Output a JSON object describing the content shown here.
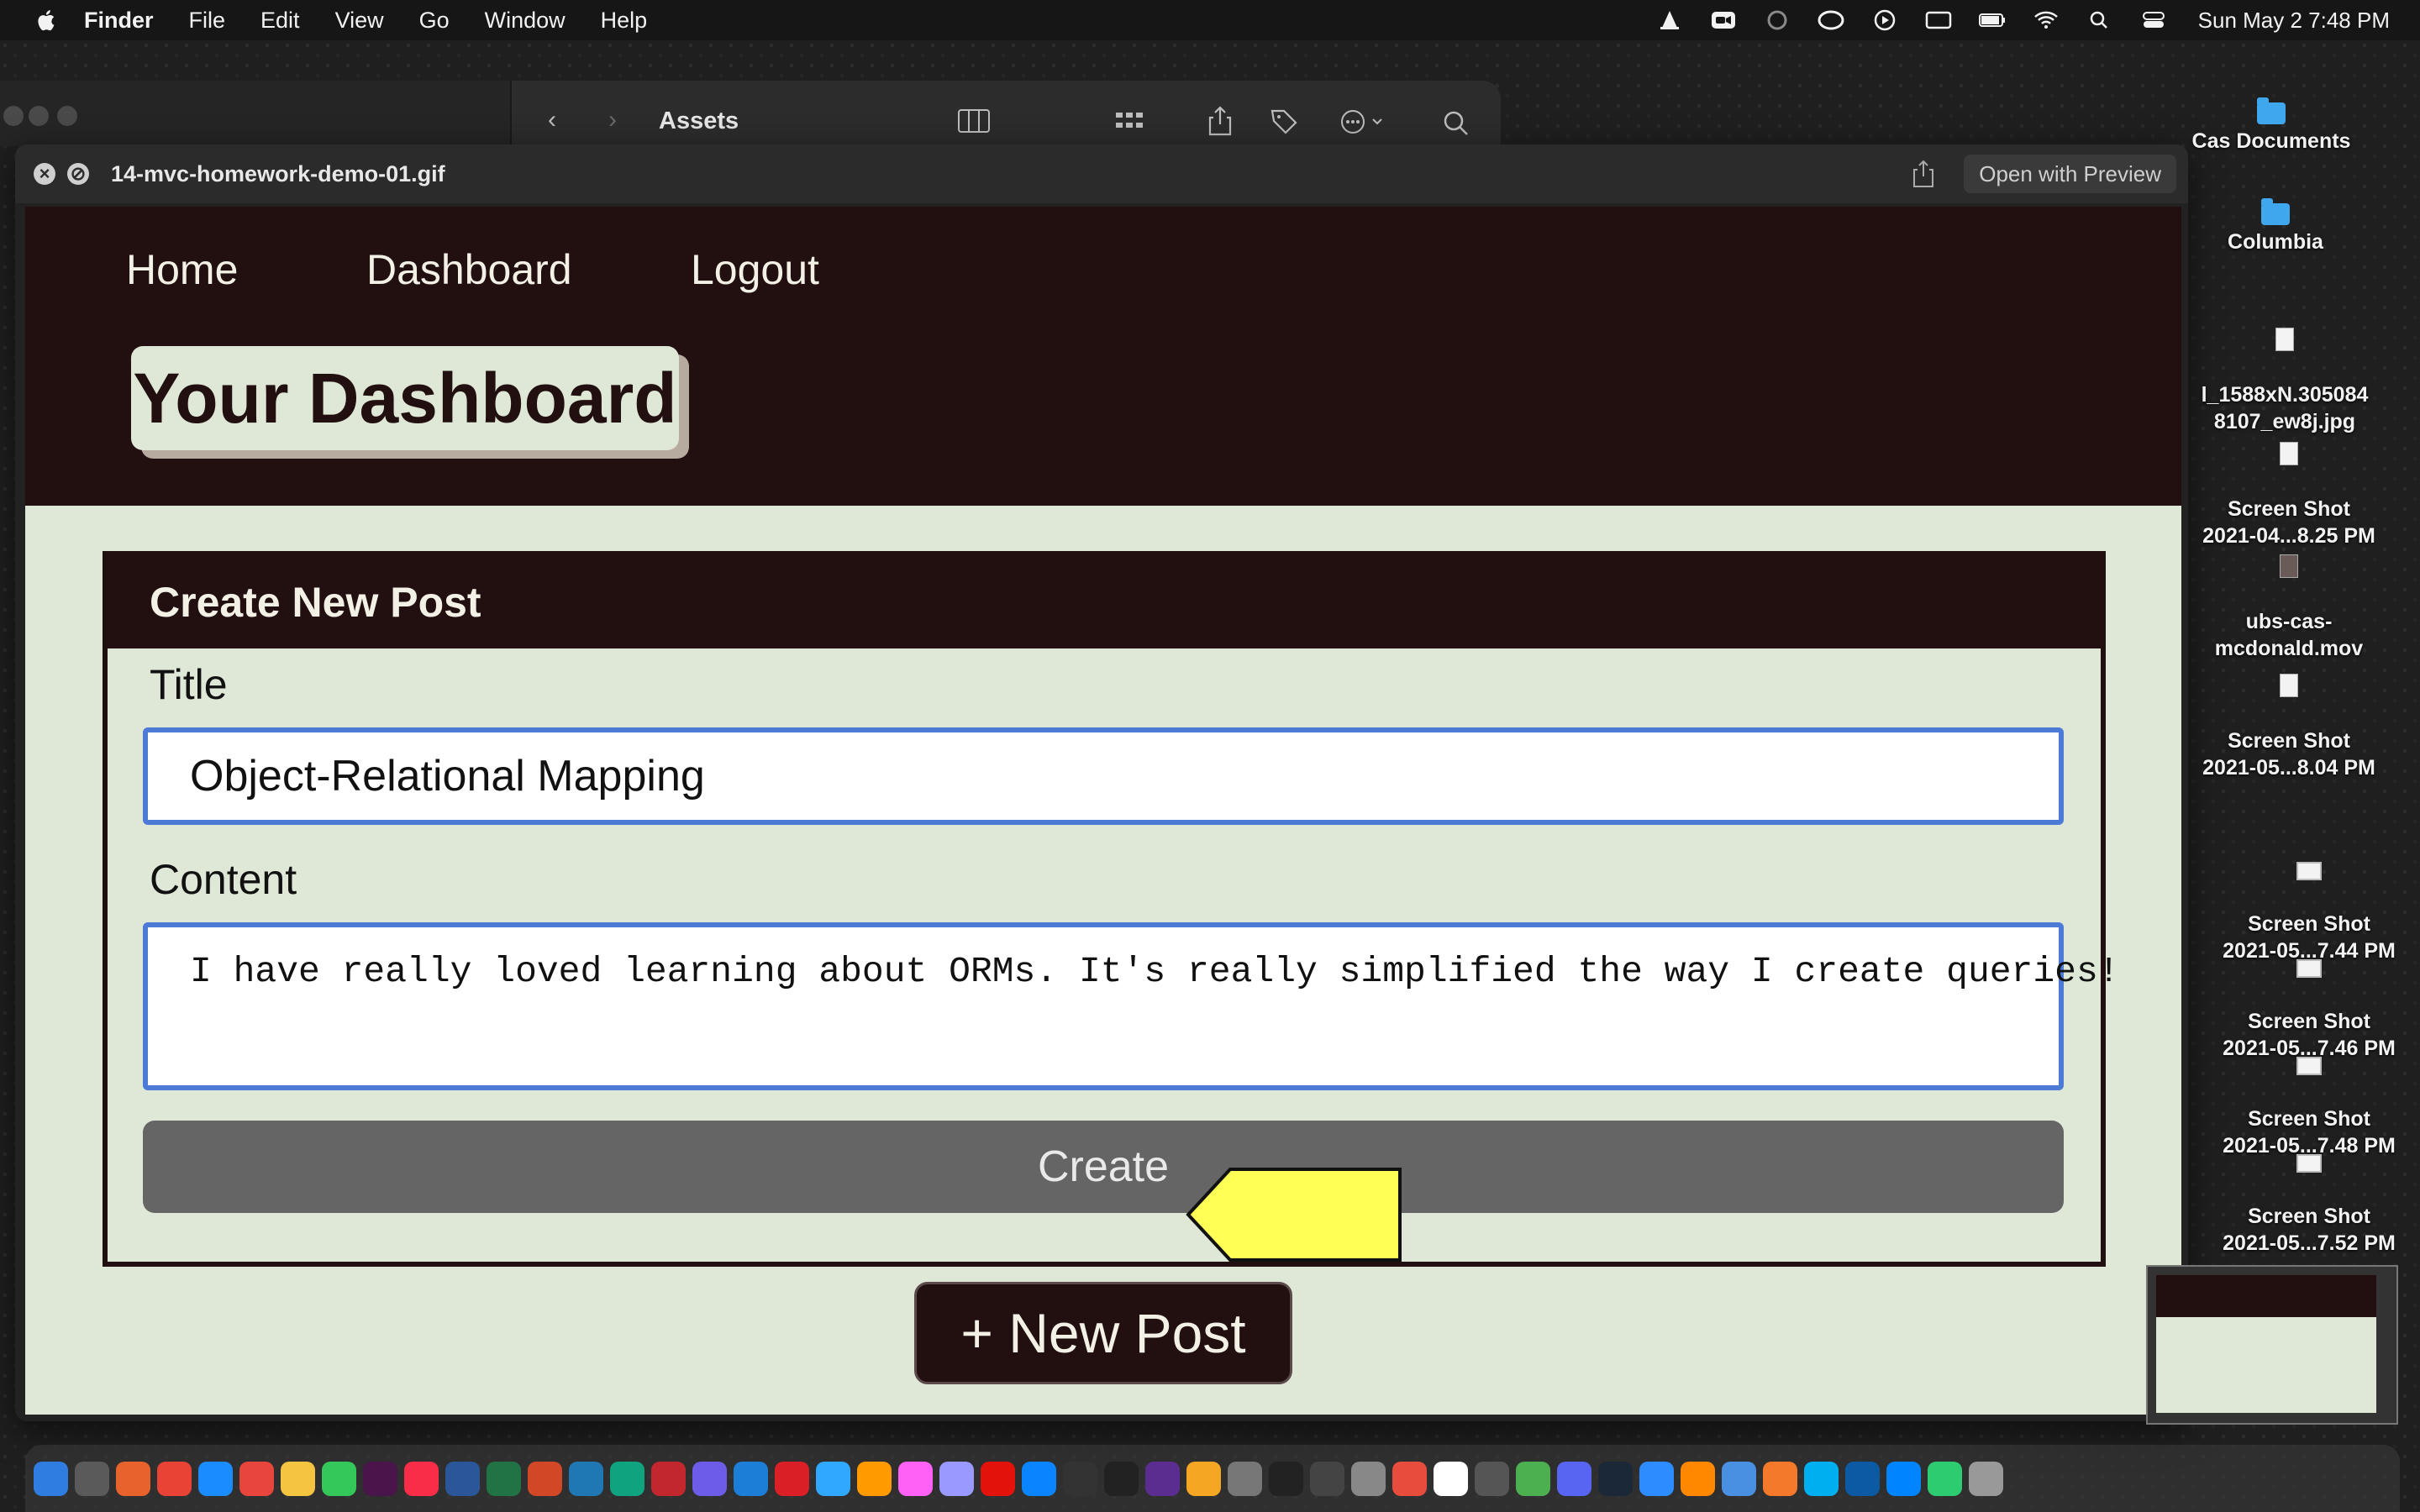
{
  "menubar": {
    "app_name": "Finder",
    "menus": [
      "File",
      "Edit",
      "View",
      "Go",
      "Window",
      "Help"
    ],
    "clock": "Sun May 2  7:48 PM"
  },
  "finder": {
    "title": "Assets"
  },
  "quicklook": {
    "filename": "14-mvc-homework-demo-01.gif",
    "open_button": "Open with Preview"
  },
  "app": {
    "nav": [
      "Home",
      "Dashboard",
      "Logout"
    ],
    "page_title": "Your Dashboard",
    "card_title": "Create New Post",
    "title_label": "Title",
    "title_value": "Object-Relational Mapping",
    "content_label": "Content",
    "content_value": "I have really loved learning about ORMs. It's really simplified the way I create queries!",
    "create_button": "Create",
    "new_post_button": "+ New Post",
    "colors": {
      "header": "#220f10",
      "background": "#dfe8d6",
      "input_border": "#4c7ad6",
      "arrow": "#ffff55"
    }
  },
  "desktop": {
    "items": [
      {
        "label": "Cas Documents",
        "icon": "folder-icon"
      },
      {
        "label": "Columbia",
        "icon": "folder-icon"
      },
      {
        "label": "l_1588xN.305084\n8107_ew8j.jpg",
        "icon": "image-file-icon"
      },
      {
        "label": "Screen Shot\n2021-04...8.25 PM",
        "icon": "screenshot-icon"
      },
      {
        "label": "ubs-cas-\nmcdonald.mov",
        "icon": "video-file-icon"
      },
      {
        "label": "Screen Shot\n2021-05...8.04 PM",
        "icon": "screenshot-icon"
      },
      {
        "label": "Screen Shot\n2021-05...7.44 PM",
        "icon": "screenshot-icon"
      },
      {
        "label": "Screen Shot\n2021-05...7.46 PM",
        "icon": "screenshot-icon"
      },
      {
        "label": "Screen Shot\n2021-05...7.48 PM",
        "icon": "screenshot-icon"
      },
      {
        "label": "Screen Shot\n2021-05...7.52 PM",
        "icon": "screenshot-icon"
      }
    ]
  },
  "dock": {
    "apps": [
      "Finder",
      "Launchpad",
      "Firefox",
      "Chrome",
      "Safari",
      "News",
      "Notes",
      "Messages",
      "Slack",
      "Music",
      "Word",
      "Excel",
      "PowerPoint",
      "Tableau",
      "ChatGPT",
      "FileZilla",
      "Proton",
      "Xcode",
      "Creative Cloud",
      "Photoshop",
      "Illustrator",
      "XD",
      "Premiere",
      "Acrobat",
      "App Store",
      "Activity Monitor",
      "Terminal",
      "Visual Studio",
      "Photos",
      "Launchpad Grid",
      "Unity",
      "Chess",
      "Settings",
      "Reminders",
      "Calendar",
      "Calculator",
      "Maps",
      "Discord",
      "Steam",
      "Zoom",
      "VLC",
      "Preview",
      "Blender",
      "Skype",
      "Edge",
      "Messenger",
      "FaceTime",
      "Trash"
    ]
  }
}
